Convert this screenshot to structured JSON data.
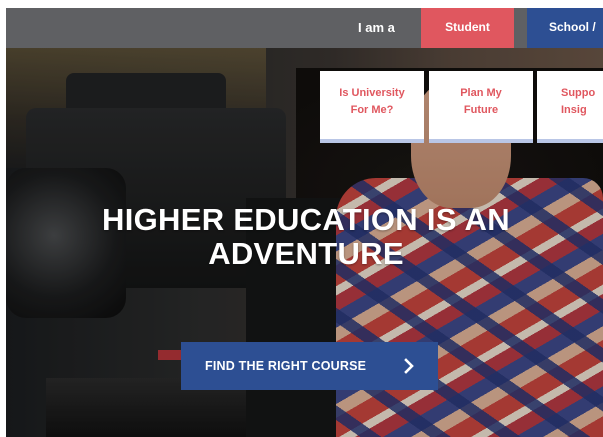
{
  "topbar": {
    "i_am_label": "I am a",
    "tabs": [
      {
        "label": "Student"
      },
      {
        "label": "School /"
      }
    ]
  },
  "menu": {
    "cards": [
      {
        "line1": "Is University",
        "line2": "For Me?"
      },
      {
        "line1": "Plan My",
        "line2": "Future"
      },
      {
        "line1": "Suppo",
        "line2": "Insig"
      }
    ]
  },
  "hero": {
    "headline_line1": "HIGHER EDUCATION IS AN",
    "headline_line2": "ADVENTURE",
    "cta_label": "FIND THE RIGHT COURSE",
    "cta_icon": "chevron-right-icon"
  },
  "colors": {
    "topbar_bg": "#5f6063",
    "student_tab": "#e0575f",
    "school_tab": "#2d4f93",
    "cta_bg": "#2d4f93",
    "card_text": "#e0575f"
  }
}
